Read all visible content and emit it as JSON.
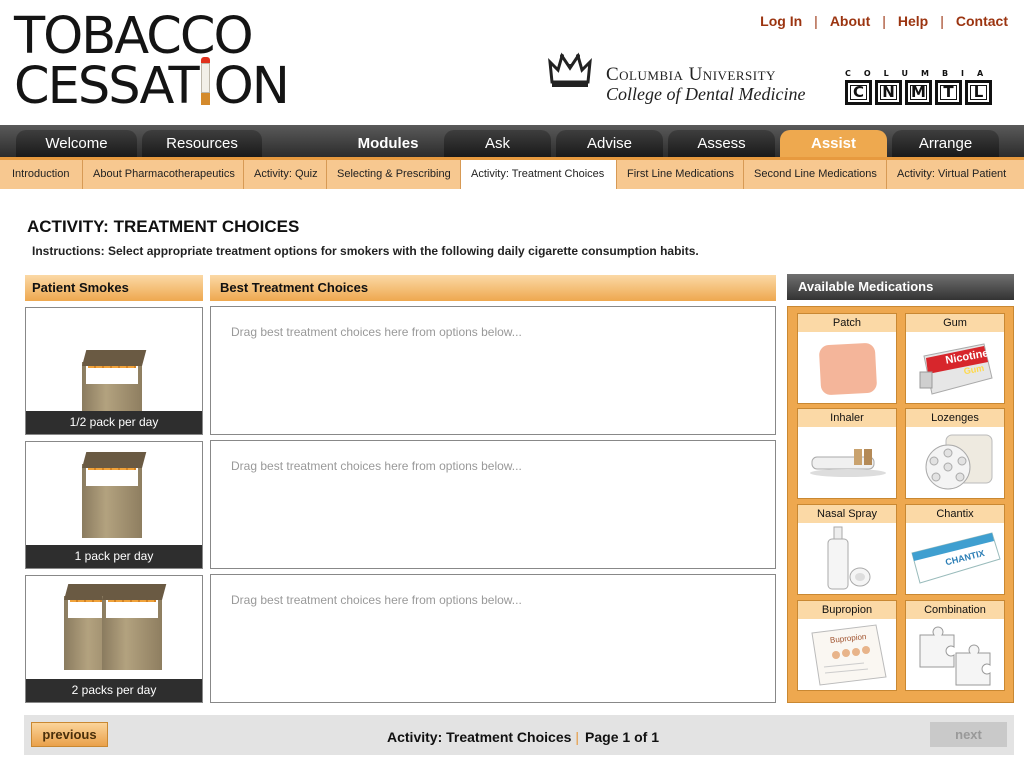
{
  "header": {
    "logo_line1": "TOBACCO",
    "logo_line2a": "CESSAT",
    "logo_line2b": "ON",
    "links": [
      "Log In",
      "About",
      "Help",
      "Contact"
    ],
    "columbia_line1": "Columbia University",
    "columbia_line2": "College of Dental Medicine",
    "cnmtl_top": "COLUMBIA",
    "cnmtl_letters": [
      "C",
      "N",
      "M",
      "T",
      "L"
    ]
  },
  "mainnav": {
    "welcome": "Welcome",
    "resources": "Resources",
    "modules": "Modules",
    "ask": "Ask",
    "advise": "Advise",
    "assess": "Assess",
    "assist": "Assist",
    "arrange": "Arrange",
    "active": "Assist"
  },
  "subnav": {
    "items": [
      "Introduction",
      "About Pharmacotherapeutics",
      "Activity: Quiz",
      "Selecting & Prescribing",
      "Activity: Treatment Choices",
      "First Line Medications",
      "Second Line Medications",
      "Activity: Virtual Patient"
    ],
    "active": "Activity: Treatment Choices"
  },
  "content": {
    "title": "ACTIVITY: TREATMENT CHOICES",
    "instructions": "Instructions: Select appropriate treatment options for smokers with the following daily cigarette consumption habits.",
    "col_patient": "Patient Smokes",
    "col_best": "Best Treatment Choices",
    "col_meds": "Available Medications",
    "rows": [
      {
        "label": "1/2 pack per day",
        "drop": "Drag best treatment choices here from options below..."
      },
      {
        "label": "1 pack per day",
        "drop": "Drag best treatment choices here from options below..."
      },
      {
        "label": "2 packs per day",
        "drop": "Drag best treatment choices here from options below..."
      }
    ],
    "medications": [
      "Patch",
      "Gum",
      "Inhaler",
      "Lozenges",
      "Nasal Spray",
      "Chantix",
      "Bupropion",
      "Combination"
    ],
    "gum_brand": "Nicotine",
    "gum_brand2": "Gum",
    "chantix_brand": "CHANTIX",
    "bupropion_brand": "Bupropion"
  },
  "footer": {
    "previous": "previous",
    "next": "next",
    "activity": "Activity: Treatment Choices",
    "separator": "|",
    "page_word": "Page",
    "page_current": "1",
    "page_of": "of",
    "page_total": "1"
  },
  "colors": {
    "accent_orange": "#eea84f",
    "link_red": "#9b3410",
    "nav_dark": "#2c2c2c"
  }
}
